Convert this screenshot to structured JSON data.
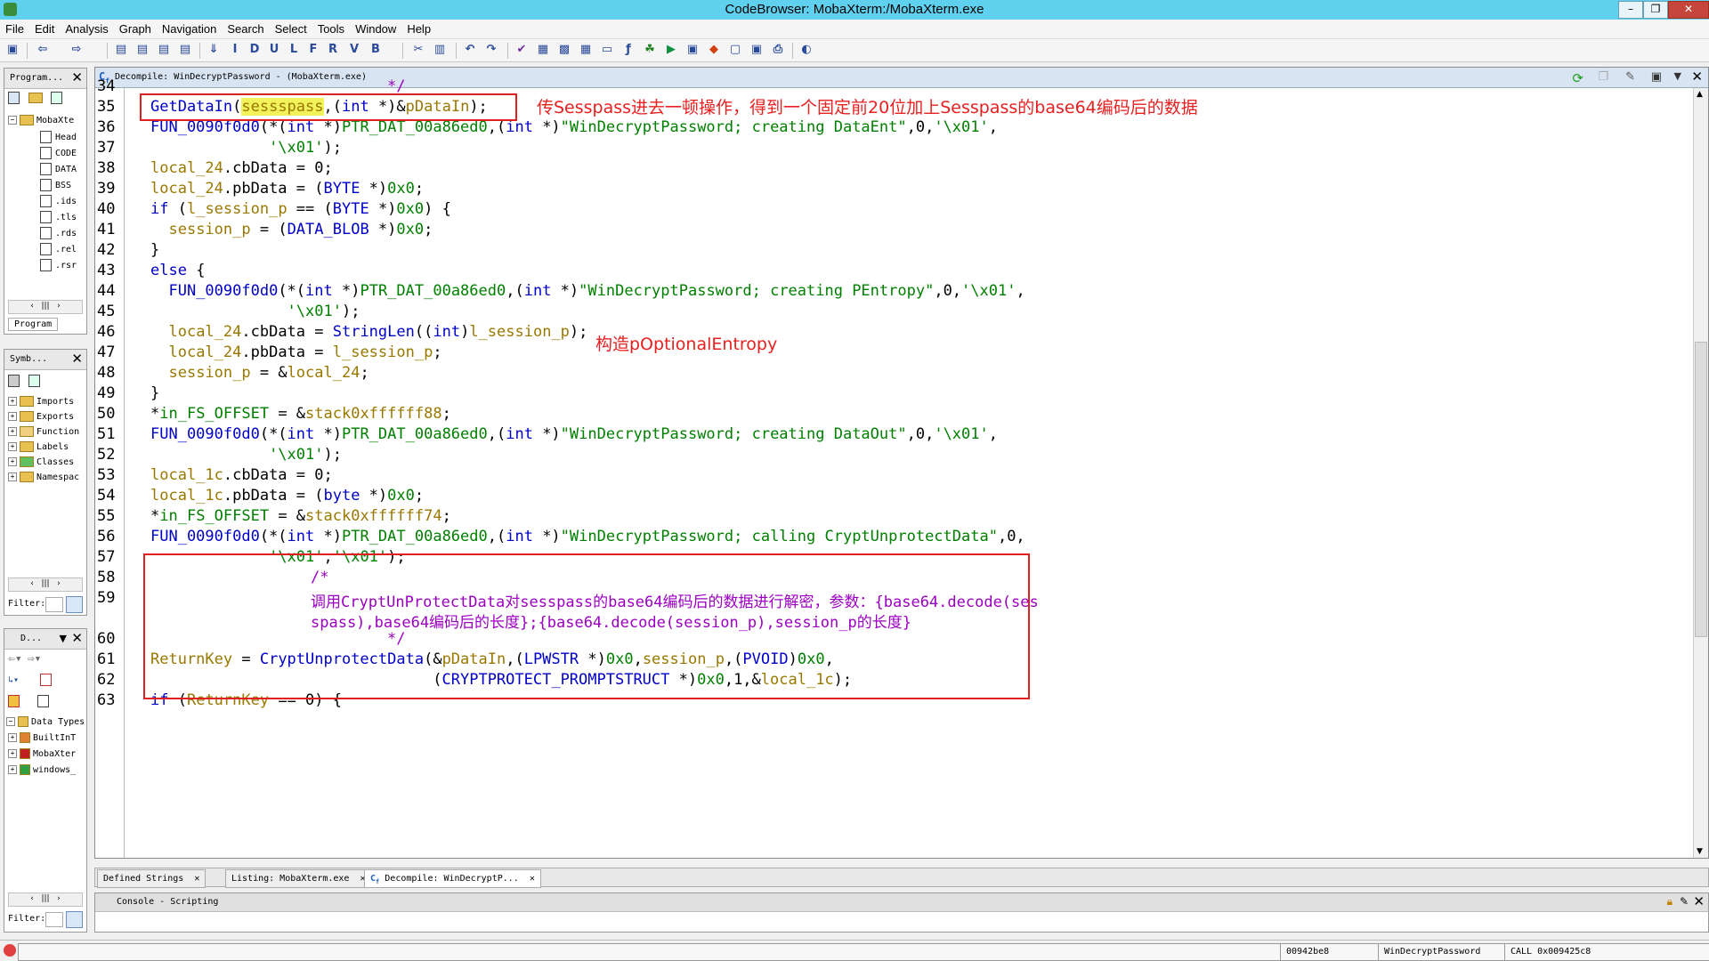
{
  "window": {
    "title": "CodeBrowser: MobaXterm:/MobaXterm.exe",
    "min": "–",
    "restore": "❐",
    "close": "✕"
  },
  "menu": [
    "File",
    "Edit",
    "Analysis",
    "Graph",
    "Navigation",
    "Search",
    "Select",
    "Tools",
    "Window",
    "Help"
  ],
  "program_tree": {
    "title": "Program...",
    "root": "MobaXte",
    "items": [
      "Head",
      "CODE",
      "DATA",
      "BSS",
      ".ids",
      ".tls",
      ".rds",
      ".rel",
      ".rsr"
    ],
    "tab": "Program"
  },
  "symbol_tree": {
    "title": "Symb...",
    "items": [
      "Imports",
      "Exports",
      "Function",
      "Labels",
      "Classes",
      "Namespac"
    ],
    "filter_label": "Filter:"
  },
  "datatype": {
    "title": "D...",
    "items": [
      "Data Types",
      "BuiltInT",
      "MobaXter",
      "windows_"
    ],
    "filter_label": "Filter:"
  },
  "decompile": {
    "title": "Decompile: WinDecryptPassword -  (MobaXterm.exe)"
  },
  "line_numbers": [
    "34",
    "35",
    "36",
    "37",
    "38",
    "39",
    "40",
    "41",
    "42",
    "43",
    "44",
    "45",
    "46",
    "47",
    "48",
    "49",
    "50",
    "51",
    "52",
    "53",
    "54",
    "55",
    "56",
    "57",
    "58",
    "59",
    "",
    "60",
    "61",
    "62",
    "63"
  ],
  "annotations": {
    "a1": "传Sesspass进去一顿操作，得到一个固定前20位加上Sesspass的base64编码后的数据",
    "a2": "构造pOptionalEntropy"
  },
  "tabs": [
    {
      "label": "Defined Strings"
    },
    {
      "label": "Listing:  MobaXterm.exe"
    },
    {
      "label": "Decompile: WinDecryptP..."
    }
  ],
  "console": {
    "title": "Console - Scripting"
  },
  "status": {
    "address": "00942be8",
    "function": "WinDecryptPassword",
    "call": "CALL 0x009425c8"
  }
}
